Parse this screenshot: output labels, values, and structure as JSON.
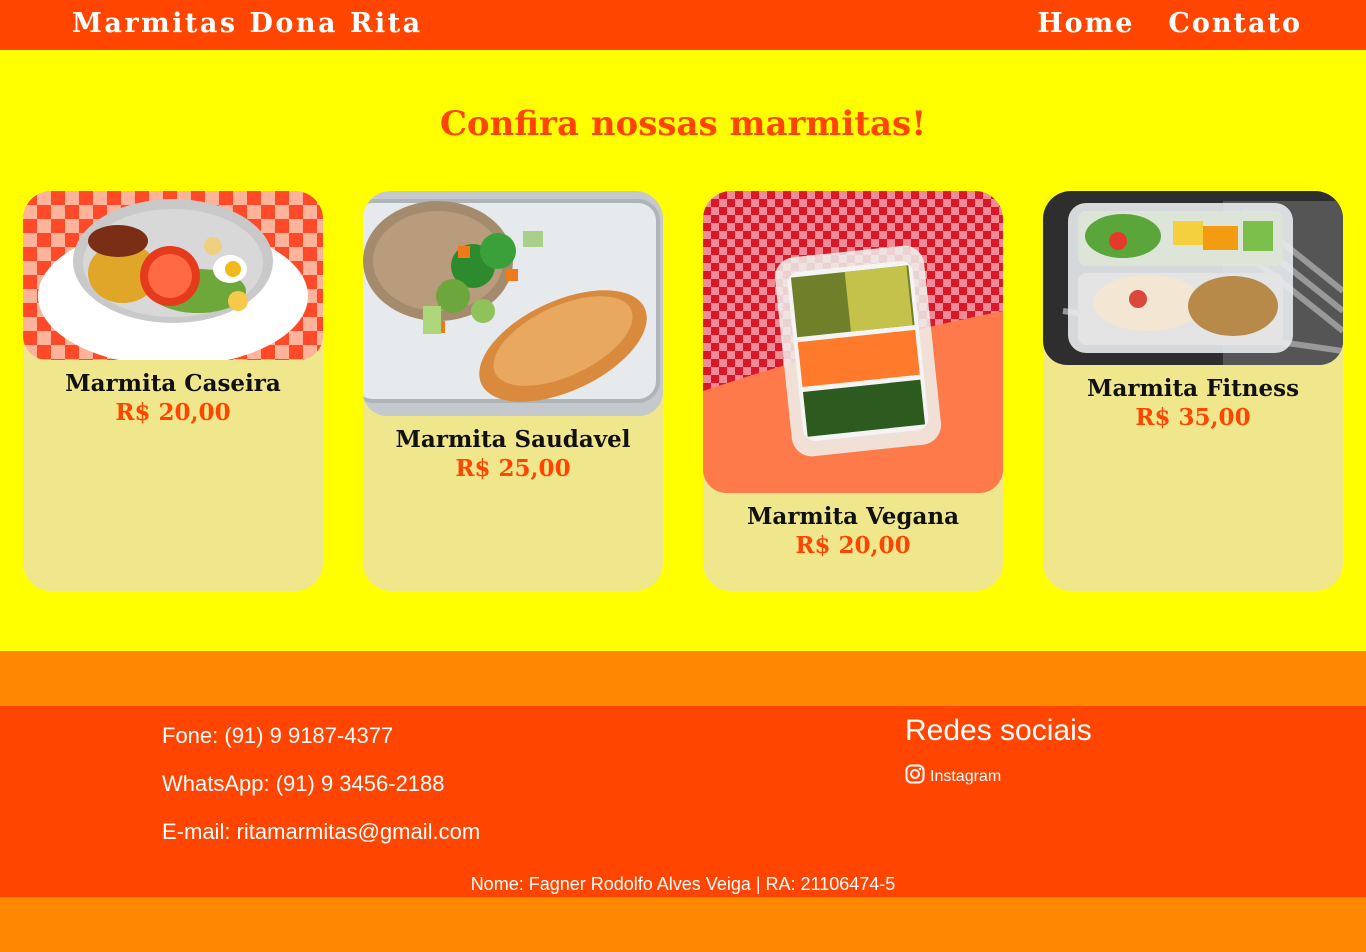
{
  "header": {
    "brand": "Marmitas Dona Rita",
    "nav": [
      {
        "label": "Home"
      },
      {
        "label": "Contato"
      }
    ]
  },
  "main": {
    "heading": "Confira nossas marmitas!",
    "cards": [
      {
        "name": "Marmita Caseira",
        "price": "R$ 20,00",
        "image_icon": "rice-and-beans-dish-image"
      },
      {
        "name": "Marmita Saudavel",
        "price": "R$ 25,00",
        "image_icon": "grilled-fish-veggies-image"
      },
      {
        "name": "Marmita Vegana",
        "price": "R$ 20,00",
        "image_icon": "vegan-salad-box-image"
      },
      {
        "name": "Marmita Fitness",
        "price": "R$ 35,00",
        "image_icon": "chicken-fit-box-image"
      }
    ]
  },
  "footer": {
    "phone": "Fone: (91) 9 9187-4377",
    "whatsapp": "WhatsApp: (91) 9 3456-2188",
    "email": "E-mail: ritamarmitas@gmail.com",
    "social_title": "Redes sociais",
    "instagram_label": "Instagram",
    "credit": "Nome: Fagner Rodolfo Alves Veiga | RA: 21106474-5"
  },
  "colors": {
    "accent": "#ff4500",
    "background": "#ffff00",
    "card": "#f0e68c",
    "band": "#ff8800"
  }
}
